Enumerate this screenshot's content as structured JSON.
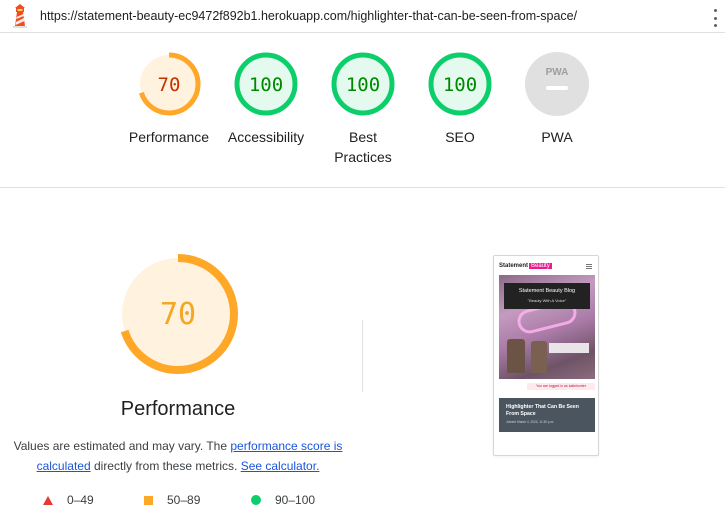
{
  "url_bar": {
    "url": "https://statement-beauty-ec9472f892b1.herokuapp.com/highlighter-that-can-be-seen-from-space/",
    "logo_icon": "lighthouse-icon",
    "menu_icon": "kebab-menu-icon"
  },
  "gauges": [
    {
      "score": "70",
      "label": "Performance",
      "value": 0.7,
      "color": "#ffa726",
      "fill": "#fff3e0",
      "text_color": "#c33300"
    },
    {
      "score": "100",
      "label": "Accessibility",
      "value": 1.0,
      "color": "#0cce6b",
      "fill": "#e5faef",
      "text_color": "#008800"
    },
    {
      "score": "100",
      "label": "Best Practices",
      "value": 1.0,
      "color": "#0cce6b",
      "fill": "#e5faef",
      "text_color": "#008800"
    },
    {
      "score": "100",
      "label": "SEO",
      "value": 1.0,
      "color": "#0cce6b",
      "fill": "#e5faef",
      "text_color": "#008800"
    },
    {
      "score": "",
      "badge": "PWA",
      "label": "PWA",
      "color": "#e0e0e0",
      "fill": "#e0e0e0"
    }
  ],
  "performance": {
    "score": "70",
    "value": 0.7,
    "title": "Performance",
    "desc_prefix": "Values are estimated and may vary. The ",
    "link_score": "performance score is calculated",
    "desc_middle": " directly from these metrics. ",
    "link_calc": "See calculator.",
    "color": "#ffa726",
    "fill": "#fff3e0",
    "text_color": "#f5a623"
  },
  "legend": [
    {
      "icon": "fail-triangle-icon",
      "range": "0–49",
      "color": "#e53935"
    },
    {
      "icon": "average-square-icon",
      "range": "50–89",
      "color": "#ffa726"
    },
    {
      "icon": "pass-circle-icon",
      "range": "90–100",
      "color": "#0cce6b"
    }
  ],
  "screenshot": {
    "brand_a": "Statement",
    "brand_b": "Beauty",
    "hero_title": "Statement Beauty Blog",
    "hero_sub": "\"Beauty With A Voice\"",
    "logged_in": "You are logged in as katiehunter",
    "card_title": "Highlighter That Can Be Seen From Space",
    "card_meta": "Joined: March 4, 2024, 11:30 p.m."
  }
}
